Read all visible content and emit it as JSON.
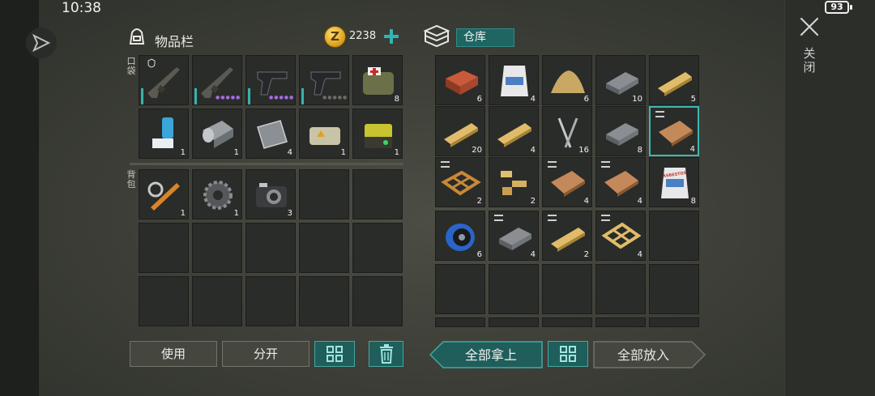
{
  "status": {
    "time": "10:38",
    "battery": "93"
  },
  "inventory": {
    "title": "物品栏",
    "coins": "2238",
    "pocket_label": "口袋",
    "backpack_label": "背包"
  },
  "warehouse": {
    "title": "仓库"
  },
  "close_label": "关闭",
  "pocket_items": [
    {
      "name": "assault-rifle-camo",
      "icon": "rifle-icon",
      "count": "",
      "dots": 0
    },
    {
      "name": "ak-rifle",
      "icon": "rifle-icon",
      "count": "",
      "dots": 5
    },
    {
      "name": "pistol",
      "icon": "pistol-icon",
      "count": "",
      "dots": 5
    },
    {
      "name": "pistol-dark",
      "icon": "pistol-icon",
      "count": "",
      "dots": 5
    },
    {
      "name": "medical-bag",
      "icon": "medkit-icon",
      "count": "8",
      "dots": 0
    },
    {
      "name": "inhaler",
      "icon": "inhaler-icon",
      "count": "1",
      "dots": 0
    },
    {
      "name": "metal-roll",
      "icon": "roll-icon",
      "count": "1",
      "dots": 0
    },
    {
      "name": "metal-plate",
      "icon": "plate-icon",
      "count": "4",
      "dots": 0
    },
    {
      "name": "warning-pack",
      "icon": "pack-icon",
      "count": "1",
      "dots": 0
    },
    {
      "name": "battery-box",
      "icon": "battery-icon",
      "count": "1",
      "dots": 0
    }
  ],
  "backpack_items": [
    {
      "name": "tool-parts",
      "icon": "tools-icon",
      "count": "1"
    },
    {
      "name": "gear-wheel",
      "icon": "gear-icon",
      "count": "1"
    },
    {
      "name": "camera",
      "icon": "camera-icon",
      "count": "3"
    }
  ],
  "warehouse_items": [
    {
      "name": "brick",
      "icon": "brick-icon",
      "count": "6",
      "stack": false
    },
    {
      "name": "cement-bag",
      "icon": "bag-icon",
      "count": "4",
      "stack": false
    },
    {
      "name": "sand-pile",
      "icon": "sand-icon",
      "count": "6",
      "stack": false
    },
    {
      "name": "copper-bar",
      "icon": "ingot-icon",
      "count": "10",
      "stack": false
    },
    {
      "name": "wood-plank",
      "icon": "plank-icon",
      "count": "5",
      "stack": false
    },
    {
      "name": "wooden-board",
      "icon": "plank-icon",
      "count": "20",
      "stack": false
    },
    {
      "name": "wooden-board-small",
      "icon": "plank-icon",
      "count": "4",
      "stack": false
    },
    {
      "name": "nails",
      "icon": "nails-icon",
      "count": "16",
      "stack": false
    },
    {
      "name": "iron-bar",
      "icon": "ingot-icon",
      "count": "8",
      "stack": false
    },
    {
      "name": "plywood-sheet",
      "icon": "sheet-icon",
      "count": "4",
      "stack": true
    },
    {
      "name": "wood-frame",
      "icon": "frame-icon",
      "count": "2",
      "stack": true
    },
    {
      "name": "wood-scraps",
      "icon": "scraps-icon",
      "count": "2",
      "stack": false
    },
    {
      "name": "copper-sheet",
      "icon": "sheet-icon",
      "count": "4",
      "stack": true
    },
    {
      "name": "steel-sheet",
      "icon": "sheet-icon",
      "count": "4",
      "stack": true
    },
    {
      "name": "asbestos-bag",
      "icon": "bag-icon",
      "count": "8",
      "stack": false,
      "label": "ASBESTOS"
    },
    {
      "name": "wire-spool",
      "icon": "spool-icon",
      "count": "6",
      "stack": false
    },
    {
      "name": "steel-bar",
      "icon": "ingot-icon",
      "count": "4",
      "stack": true
    },
    {
      "name": "wood-beam",
      "icon": "plank-icon",
      "count": "2",
      "stack": true
    },
    {
      "name": "wood-truss",
      "icon": "truss-icon",
      "count": "4",
      "stack": true
    }
  ],
  "buttons": {
    "use": "使用",
    "split": "分开",
    "take_all": "全部拿上",
    "put_all": "全部放入"
  },
  "colors": {
    "accent": "#30b5b3",
    "slot_bg": "#2a2c29",
    "background": "#3f413a"
  }
}
